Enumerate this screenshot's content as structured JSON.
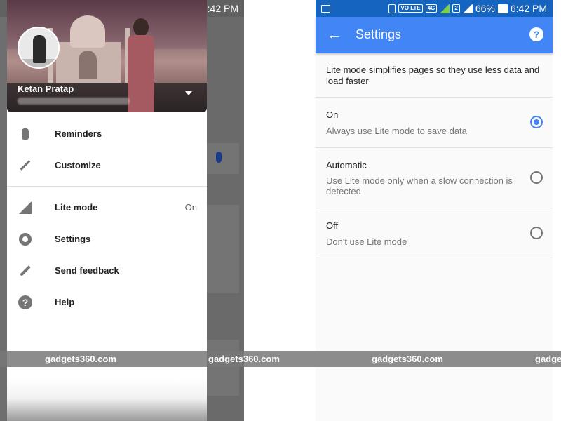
{
  "status_bar": {
    "vo_lte": "VO LTE",
    "network": "4G",
    "sim2": "2",
    "battery": "66%",
    "time": "6:42 PM"
  },
  "drawer": {
    "account_name": "Ketan Pratap",
    "menu": [
      {
        "label": "Reminders",
        "icon": "reminders-icon"
      },
      {
        "label": "Customize",
        "icon": "customize-wand-icon"
      },
      {
        "label": "Lite mode",
        "icon": "lite-mode-icon",
        "value": "On"
      },
      {
        "label": "Settings",
        "icon": "gear-icon"
      },
      {
        "label": "Send feedback",
        "icon": "pencil-icon"
      },
      {
        "label": "Help",
        "icon": "help-icon",
        "glyph": "?"
      }
    ]
  },
  "watermark": {
    "text": "gadgets360.com",
    "partial": "gadge"
  },
  "settings": {
    "title": "Settings",
    "back_icon": "arrow-back-icon",
    "help_glyph": "?",
    "description": "Lite mode simplifies pages so they use less data and load faster",
    "options": [
      {
        "title": "On",
        "subtitle": "Always use Lite mode to save data",
        "selected": true
      },
      {
        "title": "Automatic",
        "subtitle": "Use Lite mode only when a slow connection is detected",
        "selected": false
      },
      {
        "title": "Off",
        "subtitle": "Don't use Lite mode",
        "selected": false
      }
    ]
  },
  "colors": {
    "accent": "#4285f4",
    "status_bar_right": "#1565c0",
    "signal_green": "#7cd04a"
  }
}
